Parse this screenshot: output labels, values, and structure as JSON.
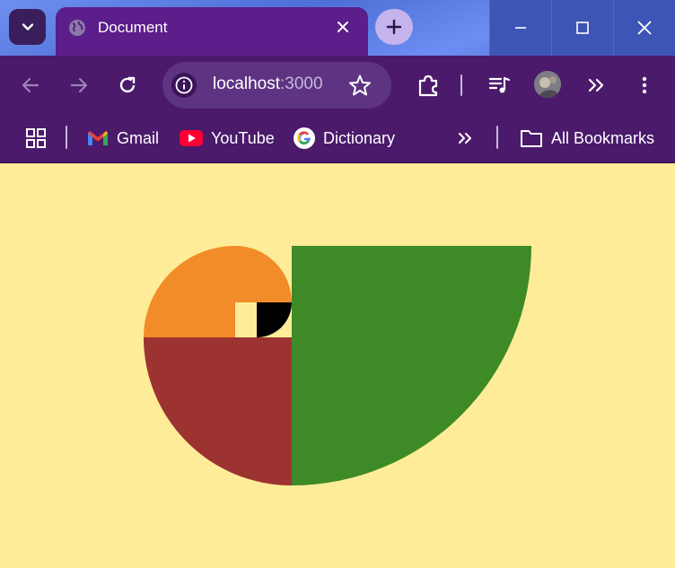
{
  "browser": {
    "tab": {
      "title": "Document"
    },
    "address": {
      "host": "localhost",
      "port": ":3000"
    },
    "bookmarks": [
      {
        "label": "Gmail",
        "icon": "gmail-icon"
      },
      {
        "label": "YouTube",
        "icon": "youtube-icon"
      },
      {
        "label": "Dictionary",
        "icon": "google-icon"
      }
    ],
    "all_bookmarks": "All Bookmarks"
  },
  "colors": {
    "page_background": "#ffec98",
    "orange": "#f28c28",
    "red_brown": "#9d3331",
    "green": "#3d8a27",
    "black": "#000000",
    "cream": "#ffec98"
  }
}
